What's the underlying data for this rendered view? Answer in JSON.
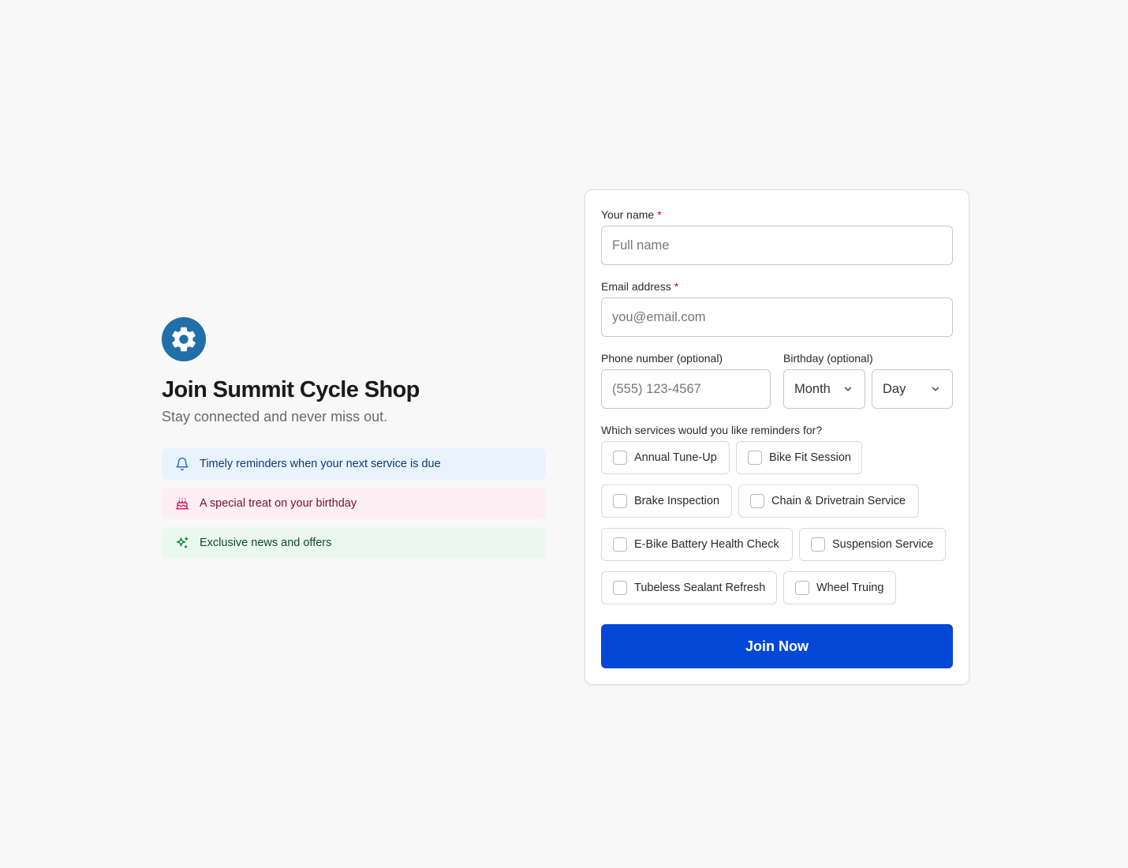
{
  "brand": {
    "logo_icon": "gear-icon",
    "logo_color": "#1f6fa8",
    "title": "Join Summit Cycle Shop",
    "subtitle": "Stay connected and never miss out."
  },
  "perks": [
    {
      "icon": "bell-icon",
      "text": "Timely reminders when your next service is due",
      "color": "#e9f3fd"
    },
    {
      "icon": "cake-icon",
      "text": "A special treat on your birthday",
      "color": "#fdeef3"
    },
    {
      "icon": "sparkles-icon",
      "text": "Exclusive news and offers",
      "color": "#ebf8ef"
    }
  ],
  "form": {
    "name": {
      "label": "Your name",
      "required_mark": "*",
      "placeholder": "Full name",
      "value": ""
    },
    "email": {
      "label": "Email address",
      "required_mark": "*",
      "placeholder": "you@email.com",
      "value": ""
    },
    "phone": {
      "label": "Phone number (optional)",
      "placeholder": "(555) 123-4567",
      "value": ""
    },
    "birthday": {
      "label": "Birthday (optional)",
      "month": "Month",
      "day": "Day"
    },
    "services": {
      "label": "Which services would you like reminders for?",
      "options": [
        "Annual Tune-Up",
        "Bike Fit Session",
        "Brake Inspection",
        "Chain & Drivetrain Service",
        "E-Bike Battery Health Check",
        "Suspension Service",
        "Tubeless Sealant Refresh",
        "Wheel Truing"
      ]
    },
    "submit_label": "Join Now",
    "accent_color": "#0448d8"
  }
}
